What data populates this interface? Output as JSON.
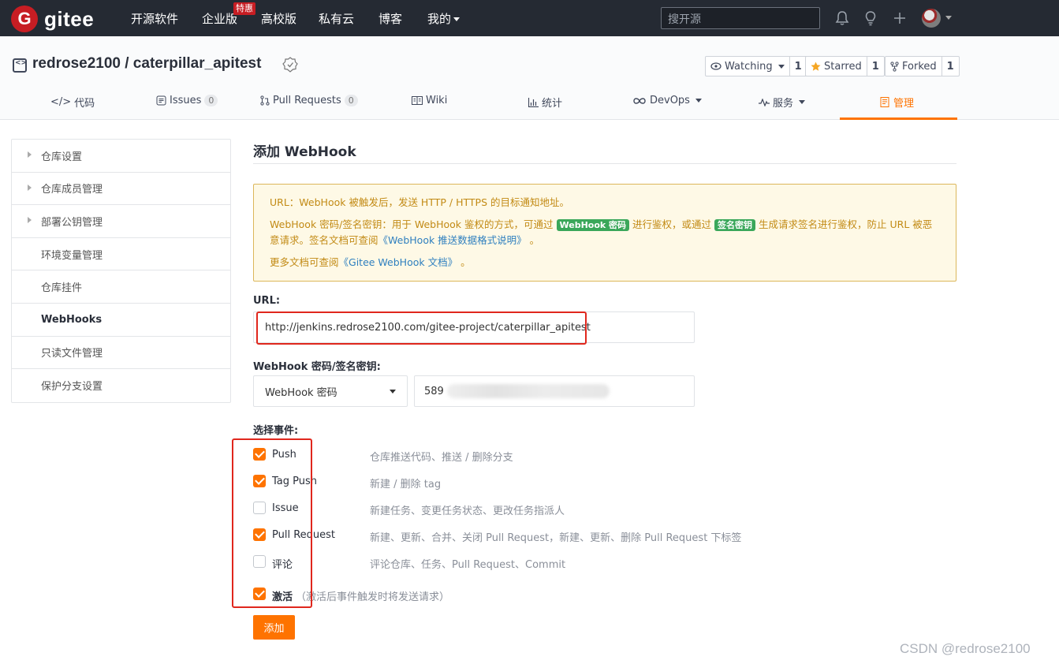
{
  "nav": {
    "logo_letter": "G",
    "logo_text": "gitee",
    "links": [
      "开源软件",
      "企业版",
      "高校版",
      "私有云",
      "博客",
      "我的"
    ],
    "badge": "特惠",
    "search_placeholder": "搜开源"
  },
  "repo": {
    "title": "redrose2100 / caterpillar_apitest",
    "watching_label": "Watching",
    "watching_count": "1",
    "starred_label": "Starred",
    "starred_count": "1",
    "forked_label": "Forked",
    "forked_count": "1"
  },
  "tabs": [
    {
      "label": "代码"
    },
    {
      "label": "Issues",
      "count": "0"
    },
    {
      "label": "Pull Requests",
      "count": "0"
    },
    {
      "label": "Wiki"
    },
    {
      "label": "统计"
    },
    {
      "label": "DevOps"
    },
    {
      "label": "服务"
    },
    {
      "label": "管理"
    }
  ],
  "sidebar": [
    "仓库设置",
    "仓库成员管理",
    "部署公钥管理",
    "环境变量管理",
    "仓库挂件",
    "WebHooks",
    "只读文件管理",
    "保护分支设置"
  ],
  "page_title": "添加 WebHook",
  "notice": {
    "line1": "URL：WebHook 被触发后，发送 HTTP / HTTPS 的目标通知地址。",
    "line2_a": "WebHook 密码/签名密钥：用于 WebHook 鉴权的方式，可通过",
    "tag1": "WebHook 密码",
    "line2_b": "进行鉴权，或通过",
    "tag2": "签名密钥",
    "line2_c": "生成请求签名进行鉴权，防止 URL 被恶意请求。签名文档可查阅",
    "link1": "《WebHook 推送数据格式说明》",
    "line2_end": "。",
    "line3_a": "更多文档可查阅",
    "link2": "《Gitee WebHook 文档》",
    "line3_end": "。"
  },
  "form": {
    "url_label": "URL:",
    "url_value": "http://jenkins.redrose2100.com/gitee-project/caterpillar_apitest",
    "secret_label": "WebHook 密码/签名密钥:",
    "secret_type": "WebHook 密码",
    "secret_prefix": "589",
    "events_label": "选择事件:",
    "events": [
      {
        "name": "Push",
        "desc": "仓库推送代码、推送 / 删除分支",
        "checked": true
      },
      {
        "name": "Tag Push",
        "desc": "新建 / 删除 tag",
        "checked": true
      },
      {
        "name": "Issue",
        "desc": "新建任务、变更任务状态、更改任务指派人",
        "checked": false
      },
      {
        "name": "Pull Request",
        "desc": "新建、更新、合并、关闭 Pull Request，新建、更新、删除 Pull Request 下标签",
        "checked": true
      },
      {
        "name": "评论",
        "desc": "评论仓库、任务、Pull Request、Commit",
        "checked": false
      }
    ],
    "activate_label": "激活",
    "activate_desc": "（激活后事件触发时将发送请求）",
    "activate_checked": true,
    "submit_label": "添加"
  },
  "watermark": "CSDN @redrose2100",
  "colors": {
    "accent": "#fe7300",
    "nav_bg": "#252a33",
    "brand_red": "#c71d23",
    "highlight": "#e0271d"
  }
}
